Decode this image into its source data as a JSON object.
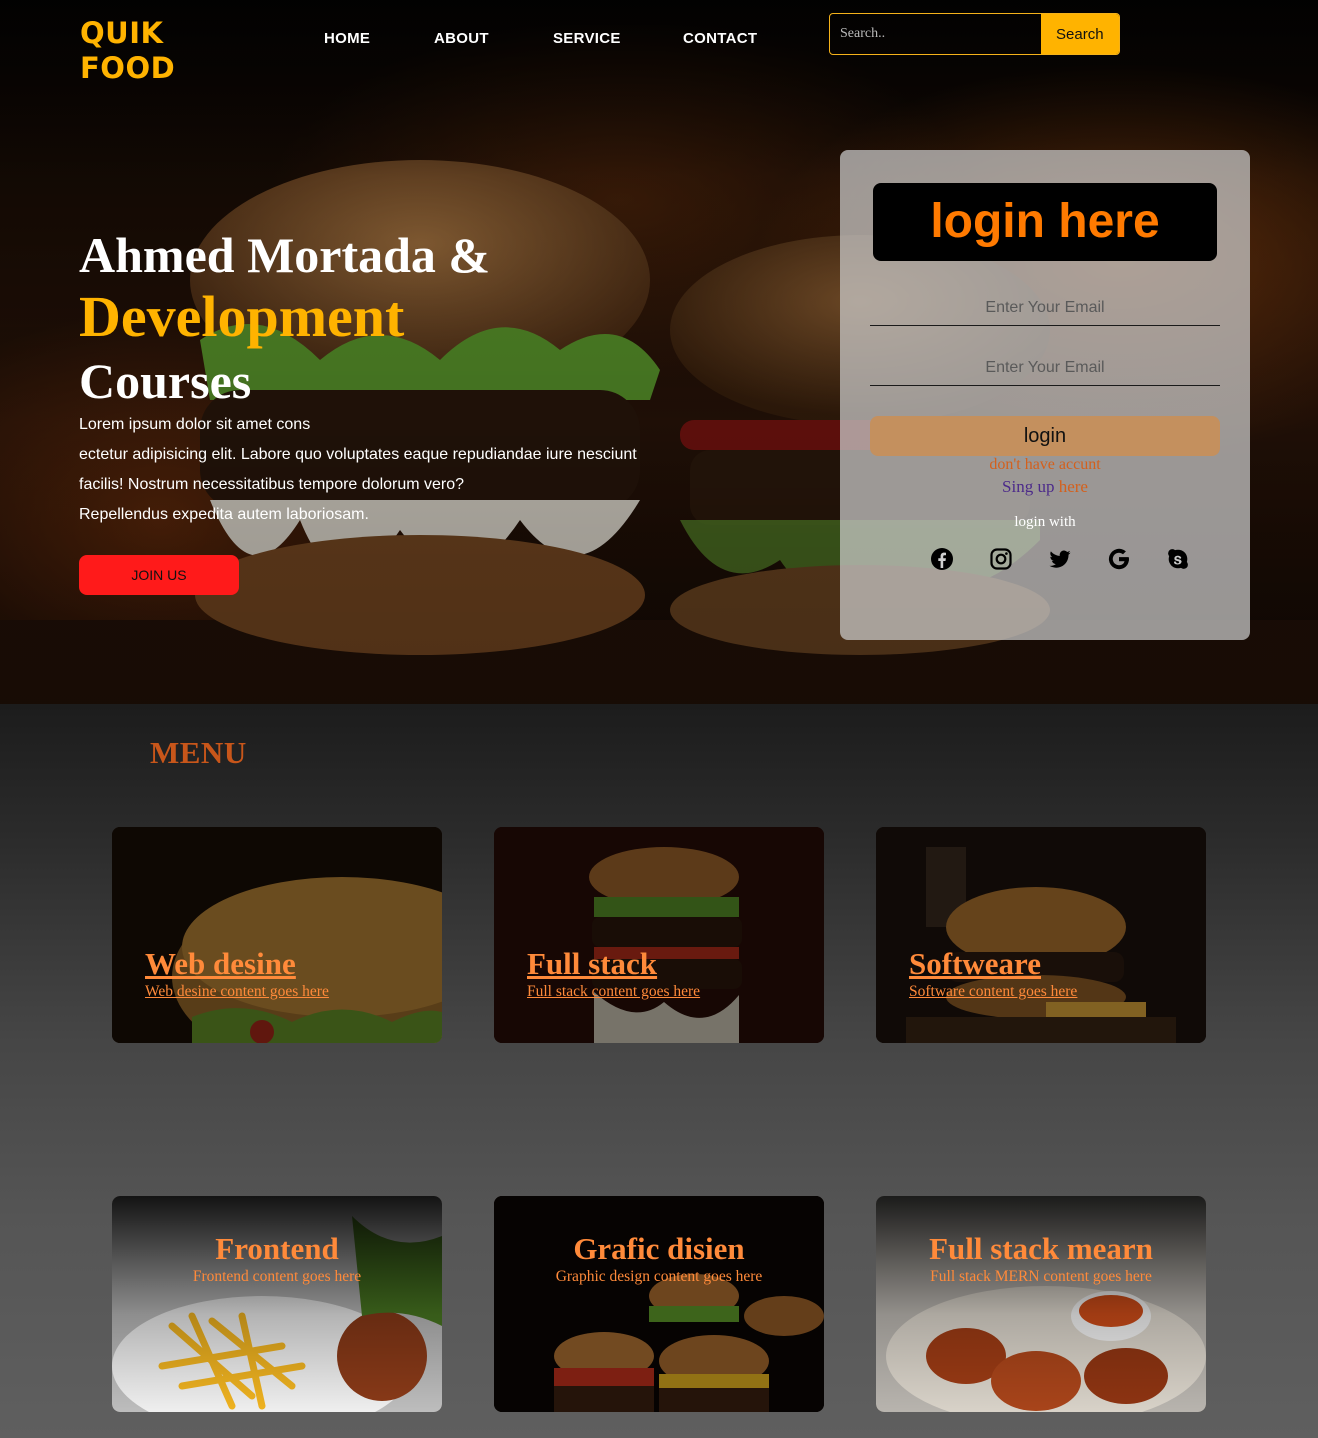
{
  "logo": {
    "line1": "QUIK",
    "line2": "FOOD"
  },
  "nav": {
    "items": [
      "HOME",
      "ABOUT",
      "SERVICE",
      "CONTACT"
    ]
  },
  "search": {
    "placeholder": "Search..",
    "button": "Search"
  },
  "hero": {
    "title_line1": "Ahmed Mortada &",
    "title_line2": "Development",
    "title_line3": "Courses",
    "desc": [
      "Lorem ipsum dolor sit amet cons",
      "ectetur adipisicing elit. Labore quo voluptates eaque repudiandae iure nesciunt",
      "facilis! Nostrum necessitatibus tempore dolorum vero?",
      "Repellendus expedita autem laboriosam."
    ],
    "join_button": "JOIN US"
  },
  "login": {
    "title": "login here",
    "email_placeholder": "Enter Your Email",
    "password_placeholder": "Enter Your Email",
    "button": "login",
    "no_account": "don't have accunt",
    "signup_part1": "Sing up",
    "signup_part2": "here",
    "login_with": "login with",
    "social_icons": [
      "facebook-icon",
      "instagram-icon",
      "twitter-icon",
      "google-icon",
      "skype-icon"
    ]
  },
  "menu": {
    "title": "MENU",
    "cards": [
      {
        "title": "Web desine",
        "subtitle": "Web desine content goes here"
      },
      {
        "title": "Full stack",
        "subtitle": "Full stack content goes here"
      },
      {
        "title": "Softweare",
        "subtitle": "Software content goes here"
      },
      {
        "title": "Frontend",
        "subtitle": "Frontend content goes here"
      },
      {
        "title": "Grafic disien",
        "subtitle": "Graphic design content goes here"
      },
      {
        "title": "Full stack mearn",
        "subtitle": "Full stack MERN content goes here"
      }
    ]
  },
  "colors": {
    "brand": "#ffb300",
    "accent_orange": "#ff7a00",
    "join_button": "#ff1a1a",
    "login_button": "#c4905e",
    "menu_title": "#c8561a",
    "card_text": "#ff8a3a"
  }
}
